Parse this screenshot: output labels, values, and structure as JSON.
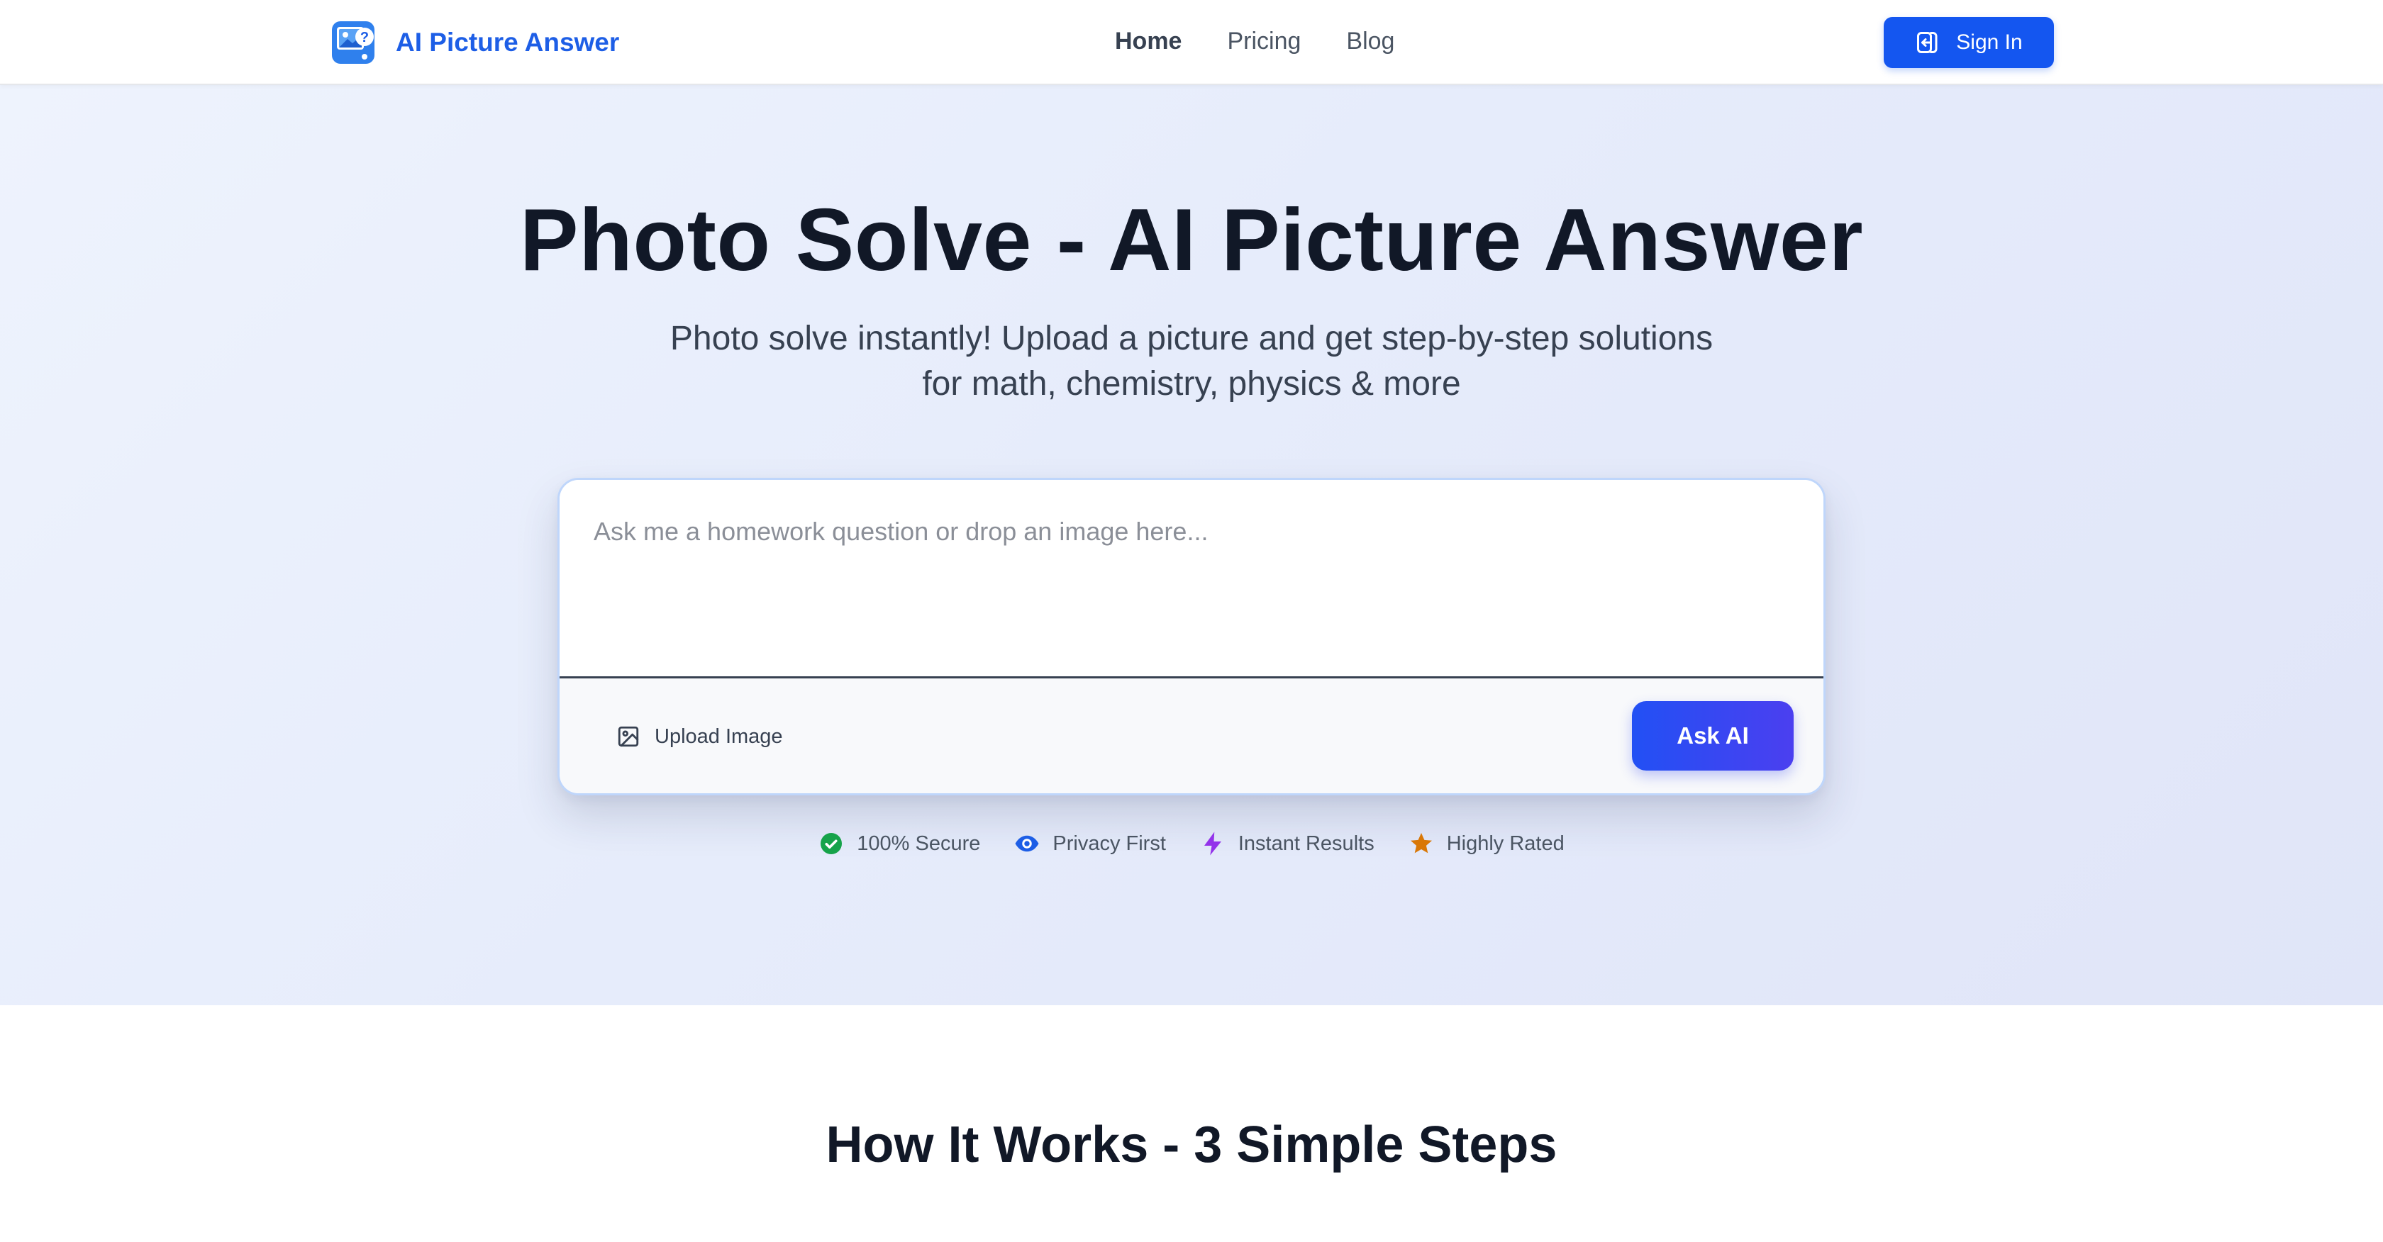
{
  "header": {
    "brand_name": "AI Picture Answer",
    "brand_logo_icon": "picture-question-icon",
    "nav": [
      {
        "label": "Home",
        "active": true
      },
      {
        "label": "Pricing",
        "active": false
      },
      {
        "label": "Blog",
        "active": false
      }
    ],
    "signin_label": "Sign In",
    "signin_icon": "sign-in-icon"
  },
  "hero": {
    "title": "Photo Solve - AI Picture Answer",
    "subtitle_line1": "Photo solve instantly! Upload a picture and get step-by-step solutions",
    "subtitle_line2": "for math, chemistry, physics & more",
    "input_placeholder": "Ask me a homework question or drop an image here...",
    "upload_label": "Upload Image",
    "upload_icon": "image-icon",
    "ask_label": "Ask AI",
    "badges": [
      {
        "label": "100% Secure",
        "icon": "check-circle-icon",
        "color": "#16a34a"
      },
      {
        "label": "Privacy First",
        "icon": "eye-icon",
        "color": "#1d5ee6"
      },
      {
        "label": "Instant Results",
        "icon": "bolt-icon",
        "color": "#9333ea"
      },
      {
        "label": "Highly Rated",
        "icon": "star-icon",
        "color": "#d97706"
      }
    ]
  },
  "how_it_works": {
    "title": "How It Works - 3 Simple Steps"
  },
  "colors": {
    "brand": "#1d5ee6",
    "primary_button": "#1456f0",
    "ask_gradient_start": "#2250f4",
    "ask_gradient_end": "#4b3ff0"
  }
}
